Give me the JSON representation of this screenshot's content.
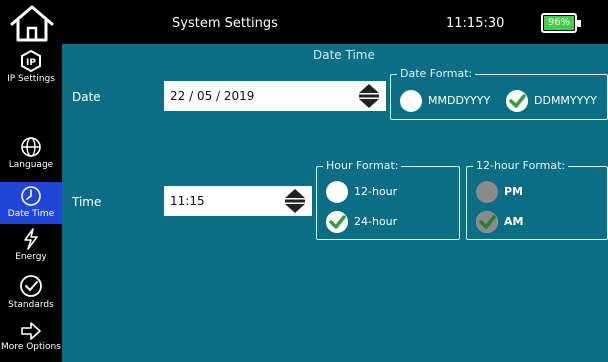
{
  "header": {
    "title": "System Settings",
    "time": "11:15:30",
    "battery": "96%",
    "battery_color": "#3fcf4a"
  },
  "sidebar": {
    "items": [
      {
        "label": "IP Settings",
        "icon": "ip-icon"
      },
      {
        "label": "Language",
        "icon": "globe-icon"
      },
      {
        "label": "Date Time",
        "icon": "clock-icon",
        "active": true
      },
      {
        "label": "Energy",
        "icon": "lightning-icon"
      },
      {
        "label": "Standards",
        "icon": "checkmark-icon"
      },
      {
        "label": "More Options",
        "icon": "arrow-right-icon"
      }
    ]
  },
  "main": {
    "section_title": "Date Time",
    "date": {
      "label": "Date",
      "value": "22 / 05 / 2019",
      "format_legend": "Date Format:",
      "options": [
        {
          "label": "MMDDYYYY",
          "selected": false
        },
        {
          "label": "DDMMYYYY",
          "selected": true
        }
      ]
    },
    "time": {
      "label": "Time",
      "value": "11:15",
      "hour_format_legend": "Hour Format:",
      "hour_options": [
        {
          "label": "12-hour",
          "selected": false
        },
        {
          "label": "24-hour",
          "selected": true
        }
      ],
      "twelve_hour_legend": "12-hour Format:",
      "ampm_options": [
        {
          "label": "PM",
          "selected": false,
          "disabled": true
        },
        {
          "label": "AM",
          "selected": true,
          "disabled": true
        }
      ]
    }
  },
  "colors": {
    "background": "#0b6e85",
    "sidebar_active": "#1f46d6",
    "check_green": "#3a9a3f"
  }
}
